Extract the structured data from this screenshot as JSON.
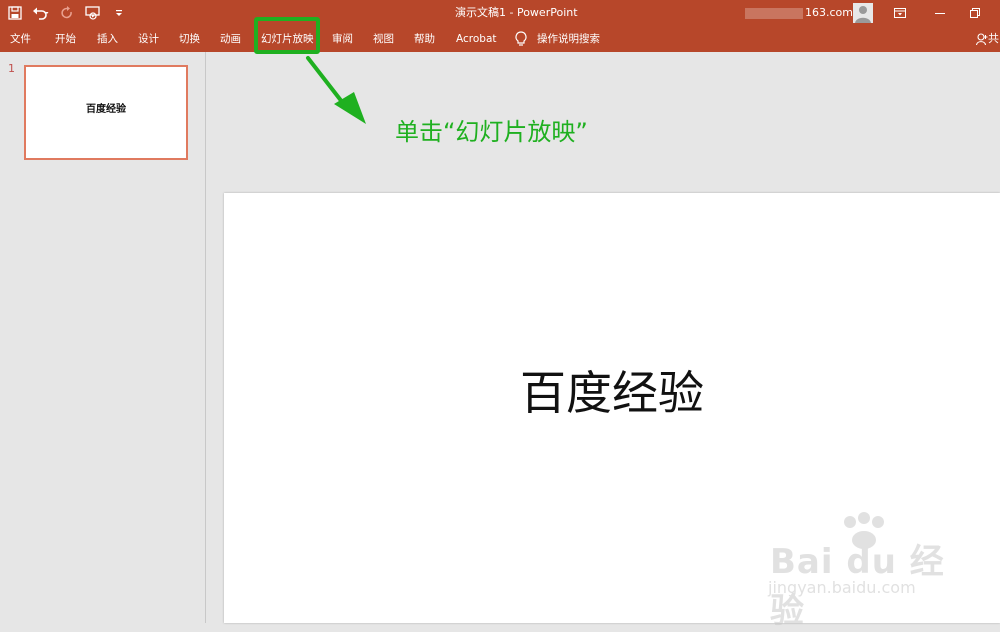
{
  "app": {
    "document_title": "演示文稿1  -  PowerPoint",
    "account": "163.com",
    "accent_color": "#b7472a"
  },
  "qat": {
    "icons": [
      "save-icon",
      "undo-icon",
      "redo-icon",
      "from-beginning-icon",
      "customize-icon"
    ]
  },
  "ribbon": {
    "tabs": [
      "文件",
      "开始",
      "插入",
      "设计",
      "切换",
      "动画",
      "幻灯片放映",
      "审阅",
      "视图",
      "帮助",
      "Acrobat"
    ],
    "tell_me": "操作说明搜索",
    "share": "共"
  },
  "thumbnails": {
    "slide_number": "1",
    "slide_text": "百度经验"
  },
  "slide": {
    "title": "百度经验"
  },
  "annotation": {
    "text": "单击“幻灯片放映”",
    "color": "#1fb020"
  },
  "watermark": {
    "brand": "Bai du 经验",
    "url": "jingyan.baidu.com"
  }
}
